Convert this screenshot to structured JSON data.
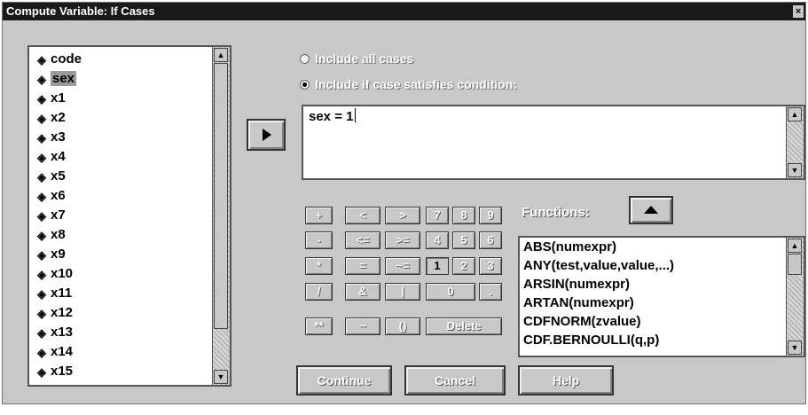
{
  "window": {
    "title": "Compute Variable: If Cases",
    "close_glyph": "×"
  },
  "variables": [
    "code",
    "sex",
    "x1",
    "x2",
    "x3",
    "x4",
    "x5",
    "x6",
    "x7",
    "x8",
    "x9",
    "x10",
    "x11",
    "x12",
    "x13",
    "x14",
    "x15"
  ],
  "selected_variable": "sex",
  "radio": {
    "all_cases": "Include all cases",
    "if_case": "Include if case satisfies condition:",
    "selected": "if_case"
  },
  "condition": {
    "value": "sex = 1"
  },
  "keypad": [
    {
      "label": "+",
      "name": "plus"
    },
    {
      "label": "<",
      "name": "less-than"
    },
    {
      "label": ">",
      "name": "greater-than"
    },
    {
      "label": "7",
      "name": "7"
    },
    {
      "label": "8",
      "name": "8"
    },
    {
      "label": "9",
      "name": "9"
    },
    {
      "label": "-",
      "name": "minus"
    },
    {
      "label": "<=",
      "name": "less-equal"
    },
    {
      "label": ">=",
      "name": "greater-equal"
    },
    {
      "label": "4",
      "name": "4"
    },
    {
      "label": "5",
      "name": "5"
    },
    {
      "label": "6",
      "name": "6"
    },
    {
      "label": "*",
      "name": "multiply"
    },
    {
      "label": "=",
      "name": "equals"
    },
    {
      "label": "~=",
      "name": "not-equal"
    },
    {
      "label": "1",
      "name": "1"
    },
    {
      "label": "2",
      "name": "2"
    },
    {
      "label": "3",
      "name": "3"
    },
    {
      "label": "/",
      "name": "divide"
    },
    {
      "label": "&",
      "name": "and"
    },
    {
      "label": "|",
      "name": "or"
    },
    {
      "label": "0",
      "name": "0"
    },
    {
      "label": ".",
      "name": "decimal"
    },
    {
      "label": "**",
      "name": "power"
    },
    {
      "label": "~",
      "name": "not"
    },
    {
      "label": "()",
      "name": "parentheses"
    },
    {
      "label": "Delete",
      "name": "delete"
    }
  ],
  "functions": {
    "label": "Functions:",
    "items": [
      "ABS(numexpr)",
      "ANY(test,value,value,...)",
      "ARSIN(numexpr)",
      "ARTAN(numexpr)",
      "CDFNORM(zvalue)",
      "CDF.BERNOULLI(q,p)"
    ]
  },
  "buttons": {
    "continue": "Continue",
    "cancel": "Cancel",
    "help": "Help"
  },
  "icons": {
    "variable_icon": "numeric-variable-icon",
    "arrow_right": "arrow-right-icon",
    "arrow_up": "arrow-up-icon"
  },
  "colors": {
    "title_bar": "#1a1a1a",
    "dialog_bg": "#c8c8c8"
  }
}
